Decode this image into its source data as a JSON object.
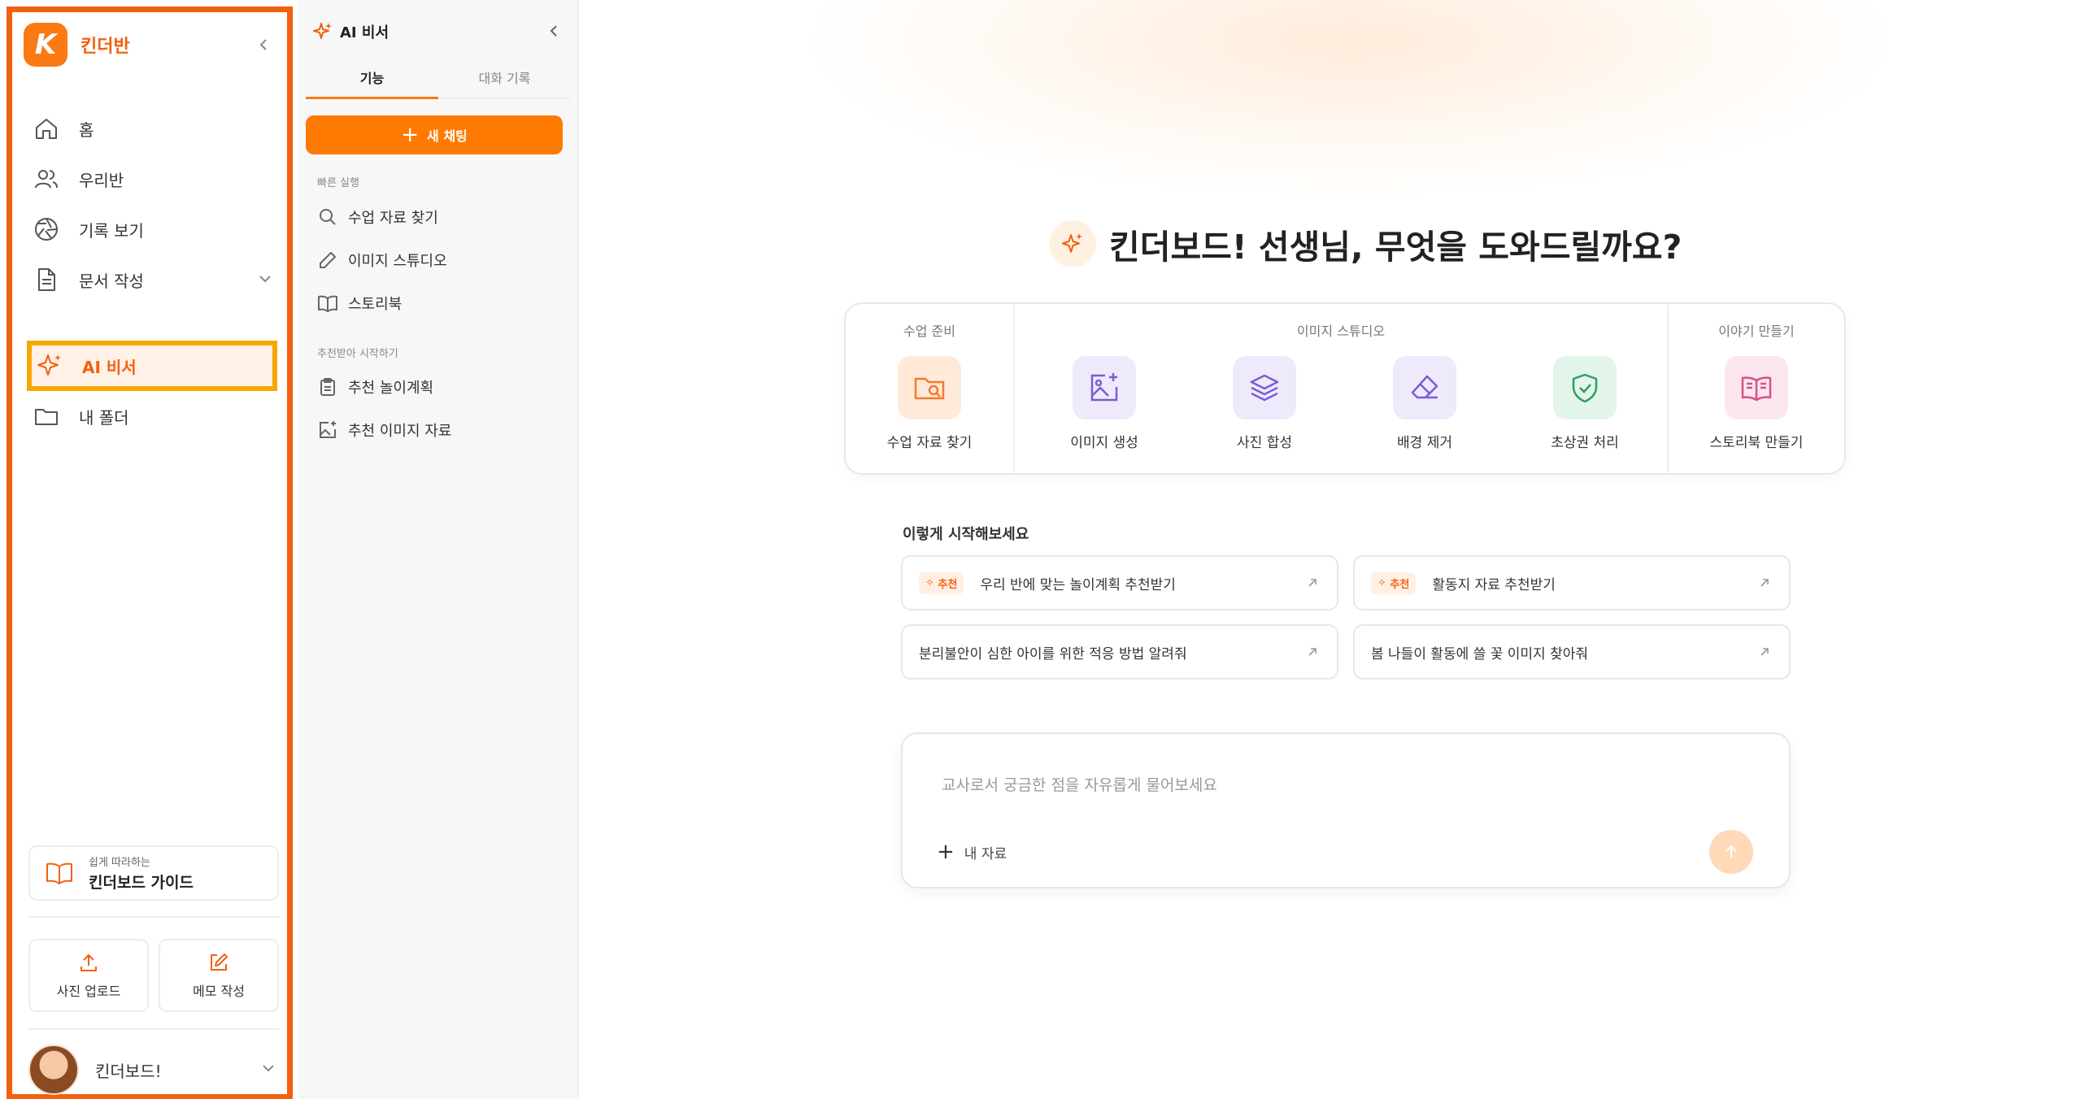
{
  "sidebar": {
    "brand": "킨더반",
    "nav": [
      {
        "label": "홈",
        "icon": "home-icon"
      },
      {
        "label": "우리반",
        "icon": "users-icon"
      },
      {
        "label": "기록 보기",
        "icon": "aperture-icon"
      },
      {
        "label": "문서 작성",
        "icon": "document-icon"
      }
    ],
    "ai_label": "AI 비서",
    "folder_label": "내 폴더",
    "guide_small": "쉽게 따라하는",
    "guide_big": "킨더보드 가이드",
    "upload_label": "사진 업로드",
    "memo_label": "메모 작성",
    "profile_name": "킨더보드!"
  },
  "panel": {
    "title": "AI 비서",
    "tabs": [
      "기능",
      "대화 기록"
    ],
    "new_chat": "새 채팅",
    "quick_label": "빠른 실행",
    "quick_items": [
      "수업 자료 찾기",
      "이미지 스튜디오",
      "스토리북"
    ],
    "rec_label": "추천받아 시작하기",
    "rec_items": [
      "추천 놀이계획",
      "추천 이미지 자료"
    ]
  },
  "main": {
    "headline": "킨더보드! 선생님, 무엇을 도와드릴까요?",
    "groups": [
      "수업 준비",
      "이미지 스튜디오",
      "이야기 만들기"
    ],
    "tools": [
      "수업 자료 찾기",
      "이미지 생성",
      "사진 합성",
      "배경 제거",
      "초상권 처리",
      "스토리북 만들기"
    ],
    "start_title": "이렇게 시작해보세요",
    "badge": "추천",
    "suggestions": [
      "우리 반에 맞는 놀이계획 추천받기",
      "활동지 자료 추천받기",
      "분리불안이 심한 아이를 위한 적응 방법 알려줘",
      "봄 나들이 활동에 쓸 꽃 이미지 찾아줘"
    ],
    "input_placeholder": "교사로서 궁금한 점을 자유롭게 물어보세요",
    "my_files": "내 자료"
  },
  "colors": {
    "accent": "#ff7a00",
    "highlight_border": "#f5a800",
    "sidebar_border": "#f3600f"
  }
}
